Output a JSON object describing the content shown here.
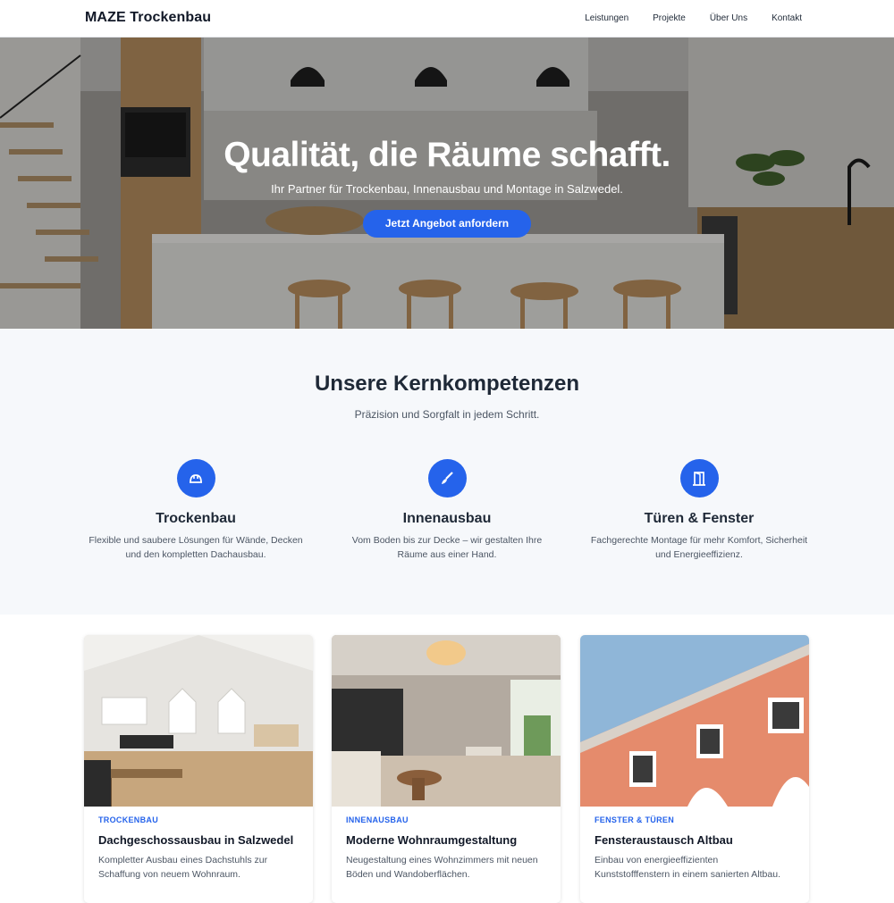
{
  "brand": "MAZE Trockenbau",
  "nav": [
    "Leistungen",
    "Projekte",
    "Über Uns",
    "Kontakt"
  ],
  "hero": {
    "title": "Qualität, die Räume schafft.",
    "subtitle": "Ihr Partner für Trockenbau, Innenausbau und Montage in Salzwedel.",
    "cta": "Jetzt Angebot anfordern"
  },
  "competences": {
    "title": "Unsere Kernkompetenzen",
    "subtitle": "Präzision und Sorgfalt in jedem Schritt.",
    "items": [
      {
        "icon": "hard-hat-icon",
        "title": "Trockenbau",
        "text": "Flexible und saubere Lösungen für Wände, Decken und den kompletten Dachausbau."
      },
      {
        "icon": "paint-brush-icon",
        "title": "Innenausbau",
        "text": "Vom Boden bis zur Decke – wir gestalten Ihre Räume aus einer Hand."
      },
      {
        "icon": "door-icon",
        "title": "Türen & Fenster",
        "text": "Fachgerechte Montage für mehr Komfort, Sicherheit und Energieeffizienz."
      }
    ]
  },
  "projects": [
    {
      "category": "TROCKENBAU",
      "title": "Dachgeschossausbau in Salzwedel",
      "text": "Kompletter Ausbau eines Dachstuhls zur Schaffung von neuem Wohnraum."
    },
    {
      "category": "INNENAUSBAU",
      "title": "Moderne Wohnraumgestaltung",
      "text": "Neugestaltung eines Wohnzimmers mit neuen Böden und Wandoberflächen."
    },
    {
      "category": "FENSTER & TÜREN",
      "title": "Fensteraustausch Altbau",
      "text": "Einbau von energieeffizienten Kunststofffenstern in einem sanierten Altbau."
    }
  ],
  "colors": {
    "accent": "#2563eb",
    "section_bg": "#f6f8fb",
    "text": "#1f2937"
  }
}
